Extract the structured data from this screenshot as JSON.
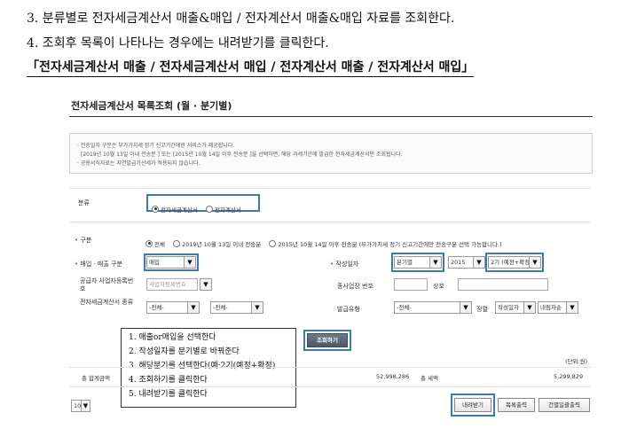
{
  "doc": {
    "line3": "3. 분류별로 전자세금계산서 매출&매입 / 전자계산서 매출&매입 자료를 조회한다.",
    "line4": "4. 조회후 목록이 나타나는 경우에는 내려받기를 클릭한다.",
    "line5": "「전자세금계산서 매출 / 전자세금계산서 매입 / 전자계산서 매출 / 전자계산서 매입」"
  },
  "page": {
    "title": "전자세금계산서 목록조회 (월 · 분기별)"
  },
  "notice": {
    "lines": [
      "· 전송일자 구분은 부가가치세 정기 신고기간에만 서비스가 제공됩니다.",
      "[2019년 10월 13일 이내 전송분 ] 또는 [2015년 10월 14일 이후 전송분 ]을 선택하면, 해당 과세기간에 발급한 전자세금계산서만 조회됩니다.",
      "· 공용서식자료는 지연발급가산세가 적용되지 않습니다."
    ]
  },
  "category": {
    "label": "분류",
    "options": [
      "전자세금계산서",
      "전자계산서"
    ],
    "selected_index": 0
  },
  "filters": {
    "type_label": "구분",
    "type_options": [
      "전체",
      "2019년 10월 13일 이내 전송분",
      "2015년 10월 14일 이후 전송분 (부가가치세 정기 신고기간에만 전송구분 선택 가능합니다.)"
    ],
    "type_selected_index": 0,
    "buysell_label": "매입 · 매출 구분",
    "buysell_value": "매입",
    "date_label": "작성일자",
    "period_value": "분기별",
    "year_value": "2015",
    "quarter_value": "2기 (예정+확정)",
    "supplier_label": "공급자 사업자등록번호",
    "supplier_placeholder": "사업자등록번호",
    "branch_label": "종사업장 번호",
    "name_label": "상호",
    "kind_label": "전자세금계산서 종류",
    "kind_value_1": "-전체-",
    "kind_value_2": "-전체-",
    "issue_label": "발급유형",
    "issue_value": "-전체-",
    "sort_label": "정렬",
    "sort_value": "작성일자",
    "order_value": "내림차순"
  },
  "actions": {
    "search_label": "조회하기",
    "download_label": "내려받기",
    "print_list_label": "목록출력",
    "print_batch_label": "건별일괄출력"
  },
  "summary": {
    "unit": "(단위:원)",
    "total_label": "총 합계금액",
    "supply_amount": "52,998,286",
    "tax_label": "총 세액",
    "tax_amount": "5,299,829"
  },
  "pagination": {
    "page_size": "10"
  },
  "annotation": {
    "lines": [
      "1. 매출or매입을 선택한다",
      "2. 작성일자를 분기별로 바꿔준다",
      "3. 해당분기를 선택한다(예:2기(예정+확정)",
      "4. 조회하기를 클릭한다",
      "5. 내려받기를 클릭한다"
    ]
  }
}
